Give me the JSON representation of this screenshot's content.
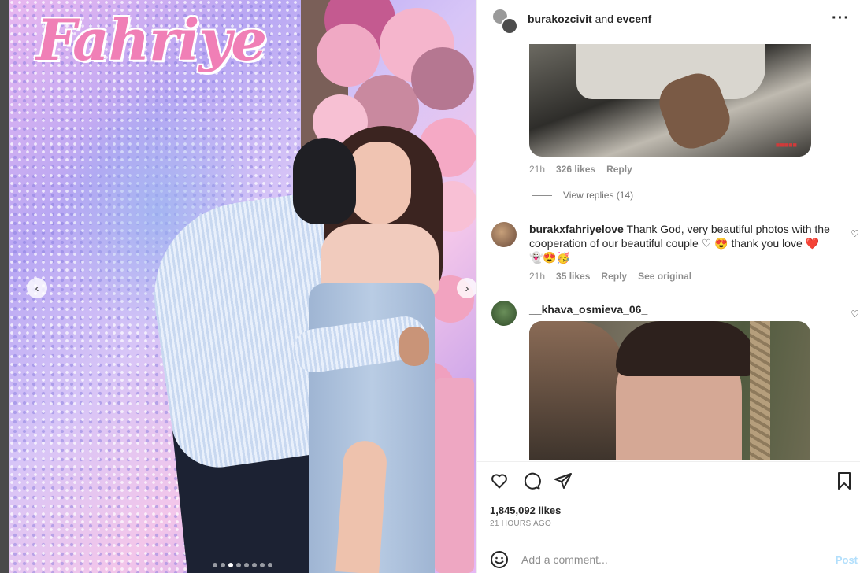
{
  "photo": {
    "sign_text": "Fahriye",
    "carousel": {
      "total": 8,
      "active_index": 2
    }
  },
  "header": {
    "user1": "burakozcivit",
    "joiner": "and",
    "user2": "evcenf",
    "more_icon": "more-horizontal-icon"
  },
  "comments": [
    {
      "time": "21h",
      "likes": "326 likes",
      "reply": "Reply",
      "view_replies": "View replies (14)"
    },
    {
      "username": "burakxfahriyelove",
      "text_line1": "Thank God, very beautiful photos with the",
      "text_line2": "cooperation of our beautiful couple ♡ 😍 thank you love ❤️",
      "text_line3": "👻😍🥳",
      "time": "21h",
      "likes": "35 likes",
      "reply": "Reply",
      "see_original": "See original"
    },
    {
      "username": "__khava_osmieva_06_"
    }
  ],
  "actions": {
    "like_icon": "heart-outline-icon",
    "comment_icon": "comment-bubble-icon",
    "share_icon": "paper-plane-icon",
    "save_icon": "bookmark-icon"
  },
  "likes": "1,845,092 likes",
  "posted": "21 HOURS AGO",
  "comment_box": {
    "placeholder": "Add a comment...",
    "post_label": "Post",
    "emoji_icon": "smiley-icon"
  }
}
